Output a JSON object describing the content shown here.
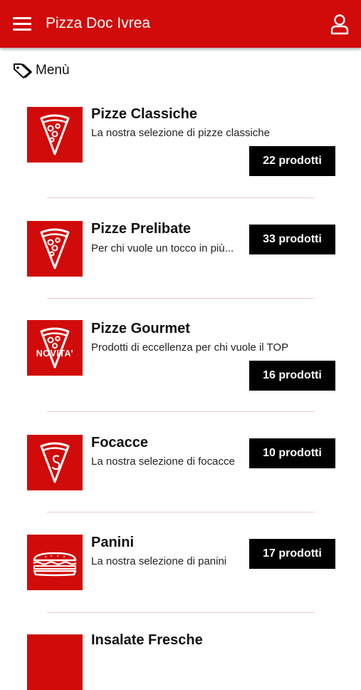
{
  "header": {
    "title": "Pizza Doc Ivrea",
    "menu_icon": "hamburger-menu-icon",
    "user_icon": "user-icon",
    "background_color": "#d10a0a"
  },
  "section": {
    "title": "Menù",
    "icon": "tag-icon"
  },
  "categories": [
    {
      "name": "Pizze Classiche",
      "description": "La nostra selezione di pizze classiche",
      "count_label": "22 prodotti",
      "icon": "pizza-slice-icon",
      "badge": ""
    },
    {
      "name": "Pizze Prelibate",
      "description": "Per chi vuole un tocco in più...",
      "count_label": "33 prodotti",
      "icon": "pizza-slice-icon",
      "badge": ""
    },
    {
      "name": "Pizze Gourmet",
      "description": "Prodotti di eccellenza per chi vuole il TOP",
      "count_label": "16 prodotti",
      "icon": "pizza-slice-icon",
      "badge": "NOVITA’"
    },
    {
      "name": "Focacce",
      "description": "La nostra selezione di focacce",
      "count_label": "10 prodotti",
      "icon": "focaccia-slice-icon",
      "badge": ""
    },
    {
      "name": "Panini",
      "description": "La nostra selezione di panini",
      "count_label": "17 prodotti",
      "icon": "sandwich-icon",
      "badge": ""
    },
    {
      "name": "Insalate Fresche",
      "description": "",
      "count_label": "",
      "icon": "salad-icon",
      "badge": ""
    }
  ]
}
